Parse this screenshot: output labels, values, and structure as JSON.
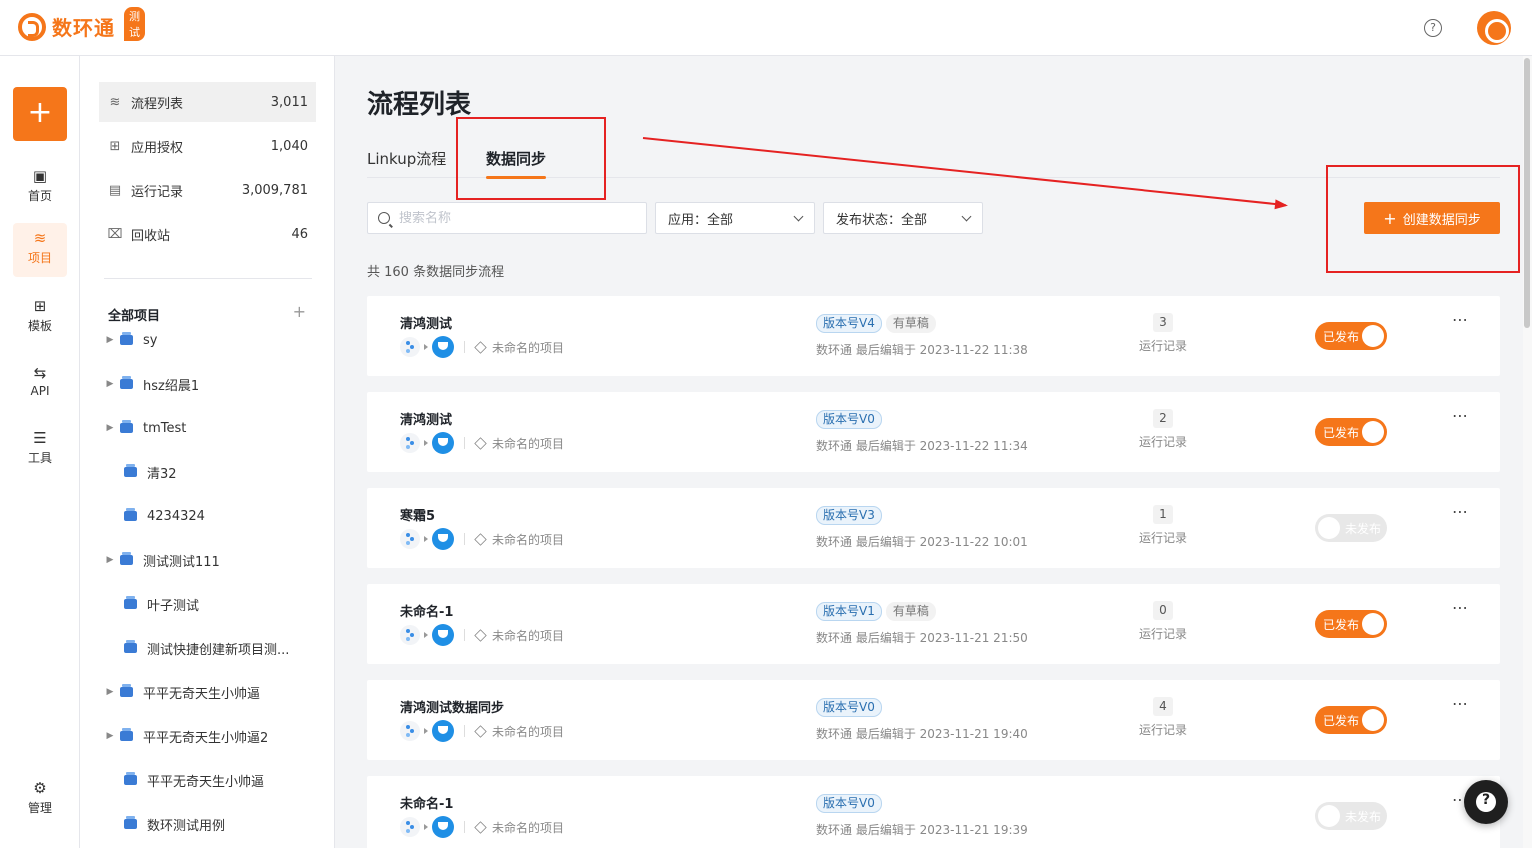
{
  "header": {
    "logo_text": "数环通",
    "env_badge": "测试",
    "help_glyph": "?"
  },
  "rail": {
    "add_glyph": "+",
    "items": [
      {
        "label": "首页",
        "icon": "home-icon",
        "glyph": "▣"
      },
      {
        "label": "项目",
        "icon": "layers-icon",
        "glyph": "≋"
      },
      {
        "label": "模板",
        "icon": "grid-icon",
        "glyph": "⊞"
      },
      {
        "label": "API",
        "icon": "api-icon",
        "glyph": "⇆"
      },
      {
        "label": "工具",
        "icon": "sliders-icon",
        "glyph": "☰"
      },
      {
        "label": "管理",
        "icon": "gear-icon",
        "glyph": "⚙"
      }
    ]
  },
  "sidebar": {
    "items": [
      {
        "label": "流程列表",
        "count": "3,011",
        "icon": "layers-icon",
        "glyph": "≋"
      },
      {
        "label": "应用授权",
        "count": "1,040",
        "icon": "grid-icon",
        "glyph": "⊞"
      },
      {
        "label": "运行记录",
        "count": "3,009,781",
        "icon": "clipboard-icon",
        "glyph": "▤"
      },
      {
        "label": "回收站",
        "count": "46",
        "icon": "trash-icon",
        "glyph": "⌧"
      }
    ],
    "projects_title": "全部项目",
    "add_glyph": "+",
    "projects": [
      {
        "label": "sy",
        "has_children": true
      },
      {
        "label": "hsz绍晨1",
        "has_children": true
      },
      {
        "label": "tmTest",
        "has_children": true
      },
      {
        "label": "清32",
        "has_children": false
      },
      {
        "label": "4234324",
        "has_children": false
      },
      {
        "label": "测试测试111",
        "has_children": true
      },
      {
        "label": "叶子测试",
        "has_children": false
      },
      {
        "label": "测试快捷创建新项目测...",
        "has_children": false
      },
      {
        "label": "平平无奇天生小帅逼",
        "has_children": true
      },
      {
        "label": "平平无奇天生小帅逼2",
        "has_children": true
      },
      {
        "label": "平平无奇天生小帅逼",
        "has_children": false
      },
      {
        "label": "数环测试用例",
        "has_children": false
      }
    ]
  },
  "main": {
    "title": "流程列表",
    "tabs": [
      {
        "label": "Linkup流程",
        "active": false
      },
      {
        "label": "数据同步",
        "active": true
      }
    ],
    "search_placeholder": "搜索名称",
    "filter_app": "应用：全部",
    "filter_status": "发布状态：全部",
    "create_glyph": "+",
    "create_label": "创建数据同步",
    "count_text": "共 160 条数据同步流程"
  },
  "flows": [
    {
      "name": "清鸿测试",
      "project": "未命名的项目",
      "version": "版本号V4",
      "draft": "有草稿",
      "edited": "数环通 最后编辑于 2023-11-22 11:38",
      "runs": "3",
      "runs_label": "运行记录",
      "published": true,
      "status": "已发布"
    },
    {
      "name": "清鸿测试",
      "project": "未命名的项目",
      "version": "版本号V0",
      "draft": "",
      "edited": "数环通 最后编辑于 2023-11-22 11:34",
      "runs": "2",
      "runs_label": "运行记录",
      "published": true,
      "status": "已发布"
    },
    {
      "name": "寒霜5",
      "project": "未命名的项目",
      "version": "版本号V3",
      "draft": "",
      "edited": "数环通 最后编辑于 2023-11-22 10:01",
      "runs": "1",
      "runs_label": "运行记录",
      "published": false,
      "status": "未发布"
    },
    {
      "name": "未命名-1",
      "project": "未命名的项目",
      "version": "版本号V1",
      "draft": "有草稿",
      "edited": "数环通 最后编辑于 2023-11-21 21:50",
      "runs": "0",
      "runs_label": "运行记录",
      "published": true,
      "status": "已发布"
    },
    {
      "name": "清鸿测试数据同步",
      "project": "未命名的项目",
      "version": "版本号V0",
      "draft": "",
      "edited": "数环通 最后编辑于 2023-11-21 19:40",
      "runs": "4",
      "runs_label": "运行记录",
      "published": true,
      "status": "已发布"
    },
    {
      "name": "未命名-1",
      "project": "未命名的项目",
      "version": "版本号V0",
      "draft": "",
      "edited": "数环通 最后编辑于 2023-11-21 19:39",
      "runs": "",
      "runs_label": "",
      "published": false,
      "status": "未发布"
    }
  ],
  "more_glyph": "⋯",
  "float_help_glyph": "?",
  "colors": {
    "accent": "#f5761a",
    "annotation": "#e52222"
  }
}
